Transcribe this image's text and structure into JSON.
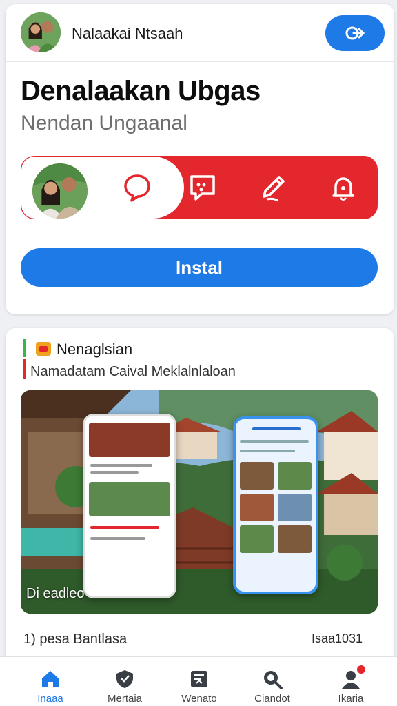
{
  "header": {
    "username": "Nalaakai Ntsaah",
    "header_button_icon": "link-icon"
  },
  "app": {
    "title": "Denalaakan Ubgas",
    "subtitle": "Nendan Ungaanal",
    "install_label": "Instal"
  },
  "actions": [
    {
      "icon": "speech-bubble-icon"
    },
    {
      "icon": "chat-square-icon"
    },
    {
      "icon": "pencil-icon"
    },
    {
      "icon": "bell-icon"
    }
  ],
  "section": {
    "title": "Nenaglsian",
    "subtitle": "Namadatam Caival Meklalnlaloan",
    "promo_caption": "Di eadleo",
    "meta_left": "1) pesa Bantlasa",
    "meta_right": "Isaa1031"
  },
  "tabs": [
    {
      "label": "Inaaa",
      "icon": "home-icon",
      "active": true
    },
    {
      "label": "Mertaia",
      "icon": "shield-icon",
      "active": false
    },
    {
      "label": "Wenato",
      "icon": "document-icon",
      "active": false
    },
    {
      "label": "Ciandot",
      "icon": "search-icon",
      "active": false
    },
    {
      "label": "Ikaria",
      "icon": "profile-icon",
      "active": false
    }
  ],
  "colors": {
    "accent_blue": "#1e7ae6",
    "accent_red": "#e4262d",
    "background": "#eef0f3"
  }
}
